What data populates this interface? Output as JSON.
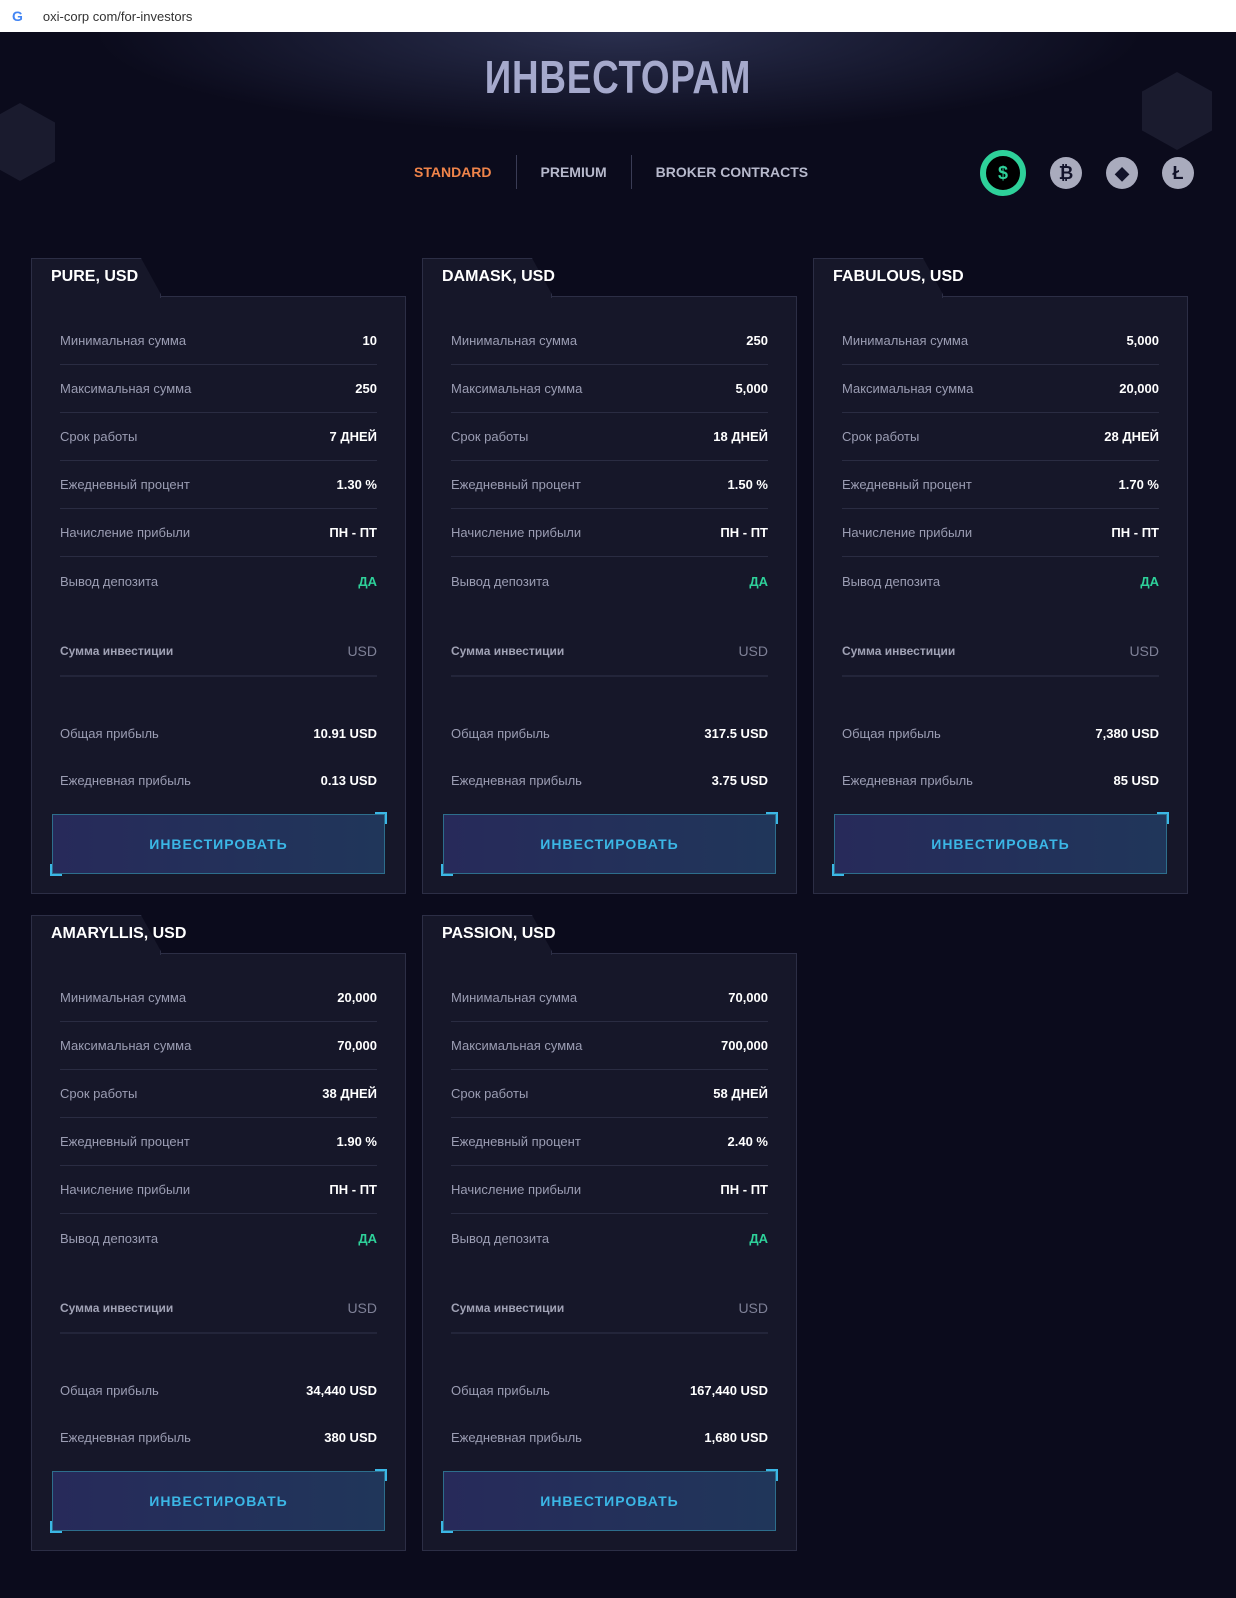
{
  "browser": {
    "icon": "google-g-icon",
    "g": "G",
    "url": "oxi-corp com/for-investors"
  },
  "page": {
    "title": "ИНВЕСТОРАМ"
  },
  "tabs": [
    {
      "label": "STANDARD",
      "active": true
    },
    {
      "label": "PREMIUM"
    },
    {
      "label": "BROKER CONTRACTS"
    }
  ],
  "coins": [
    {
      "name": "dollar",
      "glyph": "$",
      "active": true
    },
    {
      "name": "bitcoin",
      "glyph": "₿"
    },
    {
      "name": "ethereum",
      "glyph": "◆"
    },
    {
      "name": "litecoin",
      "glyph": "Ł"
    }
  ],
  "labels": {
    "min": "Минимальная сумма",
    "max": "Максимальная сумма",
    "term": "Срок работы",
    "daily_pct": "Ежедневный процент",
    "accrual": "Начисление прибыли",
    "withdraw": "Вывод депозита",
    "invest_amount": "Сумма инвестиции",
    "currency": "USD",
    "total_profit": "Общая прибыль",
    "daily_profit": "Ежедневная прибыль",
    "button": "ИНВЕСТИРОВАТЬ"
  },
  "plans": [
    {
      "title": "PURE, USD",
      "min": "10",
      "max": "250",
      "term": "7 ДНЕЙ",
      "daily_pct": "1.30 %",
      "accrual": "ПН - ПТ",
      "withdraw": "ДА",
      "total_profit": "10.91 USD",
      "daily_profit": "0.13 USD"
    },
    {
      "title": "DAMASK, USD",
      "min": "250",
      "max": "5,000",
      "term": "18 ДНЕЙ",
      "daily_pct": "1.50 %",
      "accrual": "ПН - ПТ",
      "withdraw": "ДА",
      "total_profit": "317.5 USD",
      "daily_profit": "3.75 USD"
    },
    {
      "title": "FABULOUS, USD",
      "min": "5,000",
      "max": "20,000",
      "term": "28 ДНЕЙ",
      "daily_pct": "1.70 %",
      "accrual": "ПН - ПТ",
      "withdraw": "ДА",
      "total_profit": "7,380 USD",
      "daily_profit": "85 USD"
    },
    {
      "title": "AMARYLLIS, USD",
      "min": "20,000",
      "max": "70,000",
      "term": "38 ДНЕЙ",
      "daily_pct": "1.90 %",
      "accrual": "ПН - ПТ",
      "withdraw": "ДА",
      "total_profit": "34,440 USD",
      "daily_profit": "380 USD"
    },
    {
      "title": "PASSION, USD",
      "min": "70,000",
      "max": "700,000",
      "term": "58 ДНЕЙ",
      "daily_pct": "2.40 %",
      "accrual": "ПН - ПТ",
      "withdraw": "ДА",
      "total_profit": "167,440 USD",
      "daily_profit": "1,680 USD"
    }
  ]
}
